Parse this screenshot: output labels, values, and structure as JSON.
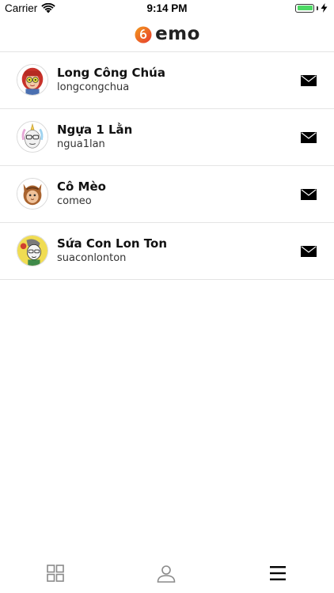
{
  "status_bar": {
    "carrier": "Carrier",
    "time": "9:14 PM",
    "battery_color": "#4cd964"
  },
  "header": {
    "logo_text": "emo",
    "logo_colors": [
      "#e63b2e",
      "#f39a1d"
    ]
  },
  "contacts": [
    {
      "name": "Long Công Chúa",
      "username": "longcongchua",
      "avatar": "red-haired-girl-avatar"
    },
    {
      "name": "Ngựa 1 Lằn",
      "username": "ngua1lan",
      "avatar": "unicorn-horse-avatar"
    },
    {
      "name": "Cô Mèo",
      "username": "comeo",
      "avatar": "cat-girl-avatar"
    },
    {
      "name": "Sứa Con Lon Ton",
      "username": "suaconlonton",
      "avatar": "doodle-girl-avatar"
    }
  ],
  "tab_bar": {
    "tabs": [
      {
        "icon": "grid-icon"
      },
      {
        "icon": "profile-icon"
      },
      {
        "icon": "menu-icon",
        "active": true
      }
    ]
  }
}
